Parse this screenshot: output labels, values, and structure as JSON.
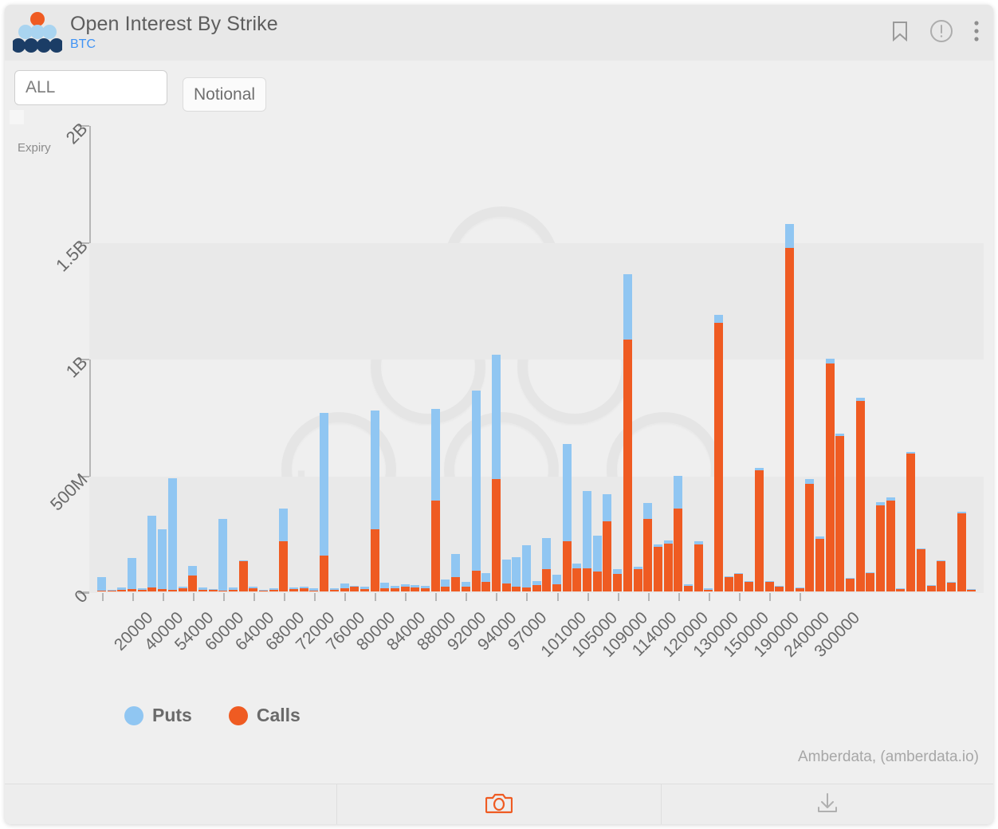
{
  "header": {
    "title": "Open Interest By Strike",
    "subtitle": "BTC",
    "icons": {
      "bookmark": "bookmark-icon",
      "info": "exclamation-circle-icon",
      "menu": "kebab-menu-icon"
    }
  },
  "controls": {
    "expiry_label": "Expiry",
    "expiry_value": "ALL",
    "notional_label": "Notional"
  },
  "footer": {
    "camera_label": "camera-icon",
    "download_label": "download-icon"
  },
  "attribution": "Amberdata, (amberdata.io)",
  "watermark_text": "amberdata",
  "colors": {
    "puts": "#90c6f2",
    "calls": "#ef5b22",
    "accent_blue": "#3f93f5",
    "axis": "#b6b6b6",
    "plot_bg": "#efefef",
    "band": "#e9e9e9",
    "tick_text": "#6a6a6a"
  },
  "chart_data": {
    "type": "bar",
    "title": "Open Interest By Strike",
    "subtitle": "BTC",
    "xlabel": "",
    "ylabel": "",
    "stacked": true,
    "grid": false,
    "legend_position": "bottom-left",
    "ylim": [
      0,
      2000000000
    ],
    "yticks": [
      0,
      500000000,
      1000000000,
      1500000000,
      2000000000
    ],
    "ytick_labels": [
      "0",
      "500M",
      "1B",
      "1.5B",
      "2B"
    ],
    "categories": [
      "20000",
      "40000",
      "54000",
      "60000",
      "64000",
      "68000",
      "72000",
      "76000",
      "80000",
      "84000",
      "88000",
      "92000",
      "94000",
      "97000",
      "101000",
      "105000",
      "109000",
      "114000",
      "120000",
      "130000",
      "150000",
      "190000",
      "240000",
      "300000"
    ],
    "tick_spacing_bars": 3,
    "legend": [
      {
        "name": "Puts",
        "color": "#90c6f2"
      },
      {
        "name": "Calls",
        "color": "#ef5b22"
      }
    ],
    "series": [
      {
        "name": "Calls",
        "color": "#ef5b22",
        "values": [
          3000000,
          4000000,
          6000000,
          9000000,
          8000000,
          18000000,
          10000000,
          8000000,
          12000000,
          70000000,
          6000000,
          6000000,
          4000000,
          8000000,
          130000000,
          12000000,
          4000000,
          7000000,
          215000000,
          10000000,
          12000000,
          5000000,
          155000000,
          7000000,
          12000000,
          20000000,
          10000000,
          265000000,
          12000000,
          14000000,
          20000000,
          18000000,
          14000000,
          390000000,
          20000000,
          60000000,
          22000000,
          90000000,
          40000000,
          480000000,
          35000000,
          22000000,
          18000000,
          26000000,
          95000000,
          32000000,
          215000000,
          100000000,
          100000000,
          85000000,
          300000000,
          75000000,
          1080000000,
          95000000,
          310000000,
          190000000,
          205000000,
          355000000,
          25000000,
          200000000,
          8000000,
          1150000000,
          60000000,
          75000000,
          40000000,
          520000000,
          40000000,
          20000000,
          1470000000,
          14000000,
          460000000,
          225000000,
          975000000,
          665000000,
          55000000,
          815000000,
          80000000,
          370000000,
          390000000,
          12000000,
          590000000,
          180000000,
          25000000,
          130000000,
          40000000,
          335000000,
          10000000
        ]
      },
      {
        "name": "Puts",
        "color": "#90c6f2",
        "values": [
          58000000,
          4000000,
          10000000,
          135000000,
          4000000,
          305000000,
          255000000,
          475000000,
          8000000,
          40000000,
          10000000,
          6000000,
          305000000,
          8000000,
          4000000,
          8000000,
          4000000,
          8000000,
          140000000,
          6000000,
          10000000,
          8000000,
          610000000,
          8000000,
          22000000,
          4000000,
          10000000,
          510000000,
          24000000,
          10000000,
          12000000,
          8000000,
          10000000,
          390000000,
          30000000,
          100000000,
          20000000,
          770000000,
          40000000,
          535000000,
          100000000,
          125000000,
          180000000,
          20000000,
          135000000,
          40000000,
          415000000,
          18000000,
          330000000,
          155000000,
          115000000,
          20000000,
          280000000,
          12000000,
          70000000,
          10000000,
          15000000,
          140000000,
          5000000,
          15000000,
          4000000,
          35000000,
          6000000,
          4000000,
          3000000,
          10000000,
          4000000,
          3000000,
          105000000,
          3000000,
          20000000,
          12000000,
          20000000,
          10000000,
          3000000,
          15000000,
          3000000,
          12000000,
          12000000,
          2000000,
          8000000,
          3000000,
          2000000,
          3000000,
          2000000,
          5000000,
          2000000
        ]
      }
    ]
  }
}
